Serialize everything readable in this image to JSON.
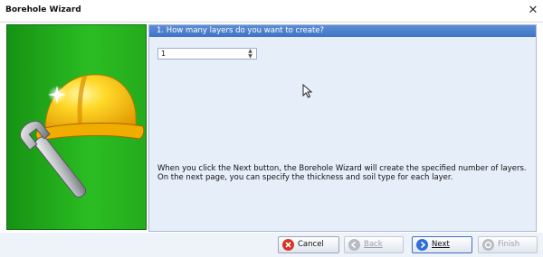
{
  "window": {
    "title": "Borehole Wizard",
    "close_glyph": "✕"
  },
  "left_panel": {
    "image": "hard-hat-wrench-icon"
  },
  "question": {
    "text": "1. How many layers do you want to create?"
  },
  "layers_spinner": {
    "value": "1"
  },
  "info_text": "When you click the Next button, the Borehole Wizard will create the specified number of layers. On the next page, you can specify the thickness and soil type for each layer.",
  "buttons": {
    "cancel": {
      "label": "Cancel",
      "enabled": true,
      "icon": "cancel-icon"
    },
    "back": {
      "label": "Back",
      "enabled": false,
      "icon": "back-arrow-icon"
    },
    "next": {
      "label": "Next",
      "enabled": true,
      "icon": "next-arrow-icon"
    },
    "finish": {
      "label": "Finish",
      "enabled": false,
      "icon": "finish-icon"
    }
  },
  "colors": {
    "panel_green": "#22a81c",
    "question_bar": "#4a7fcf",
    "content_bg": "#e6eefa",
    "footer_bg": "#eef2f9"
  }
}
